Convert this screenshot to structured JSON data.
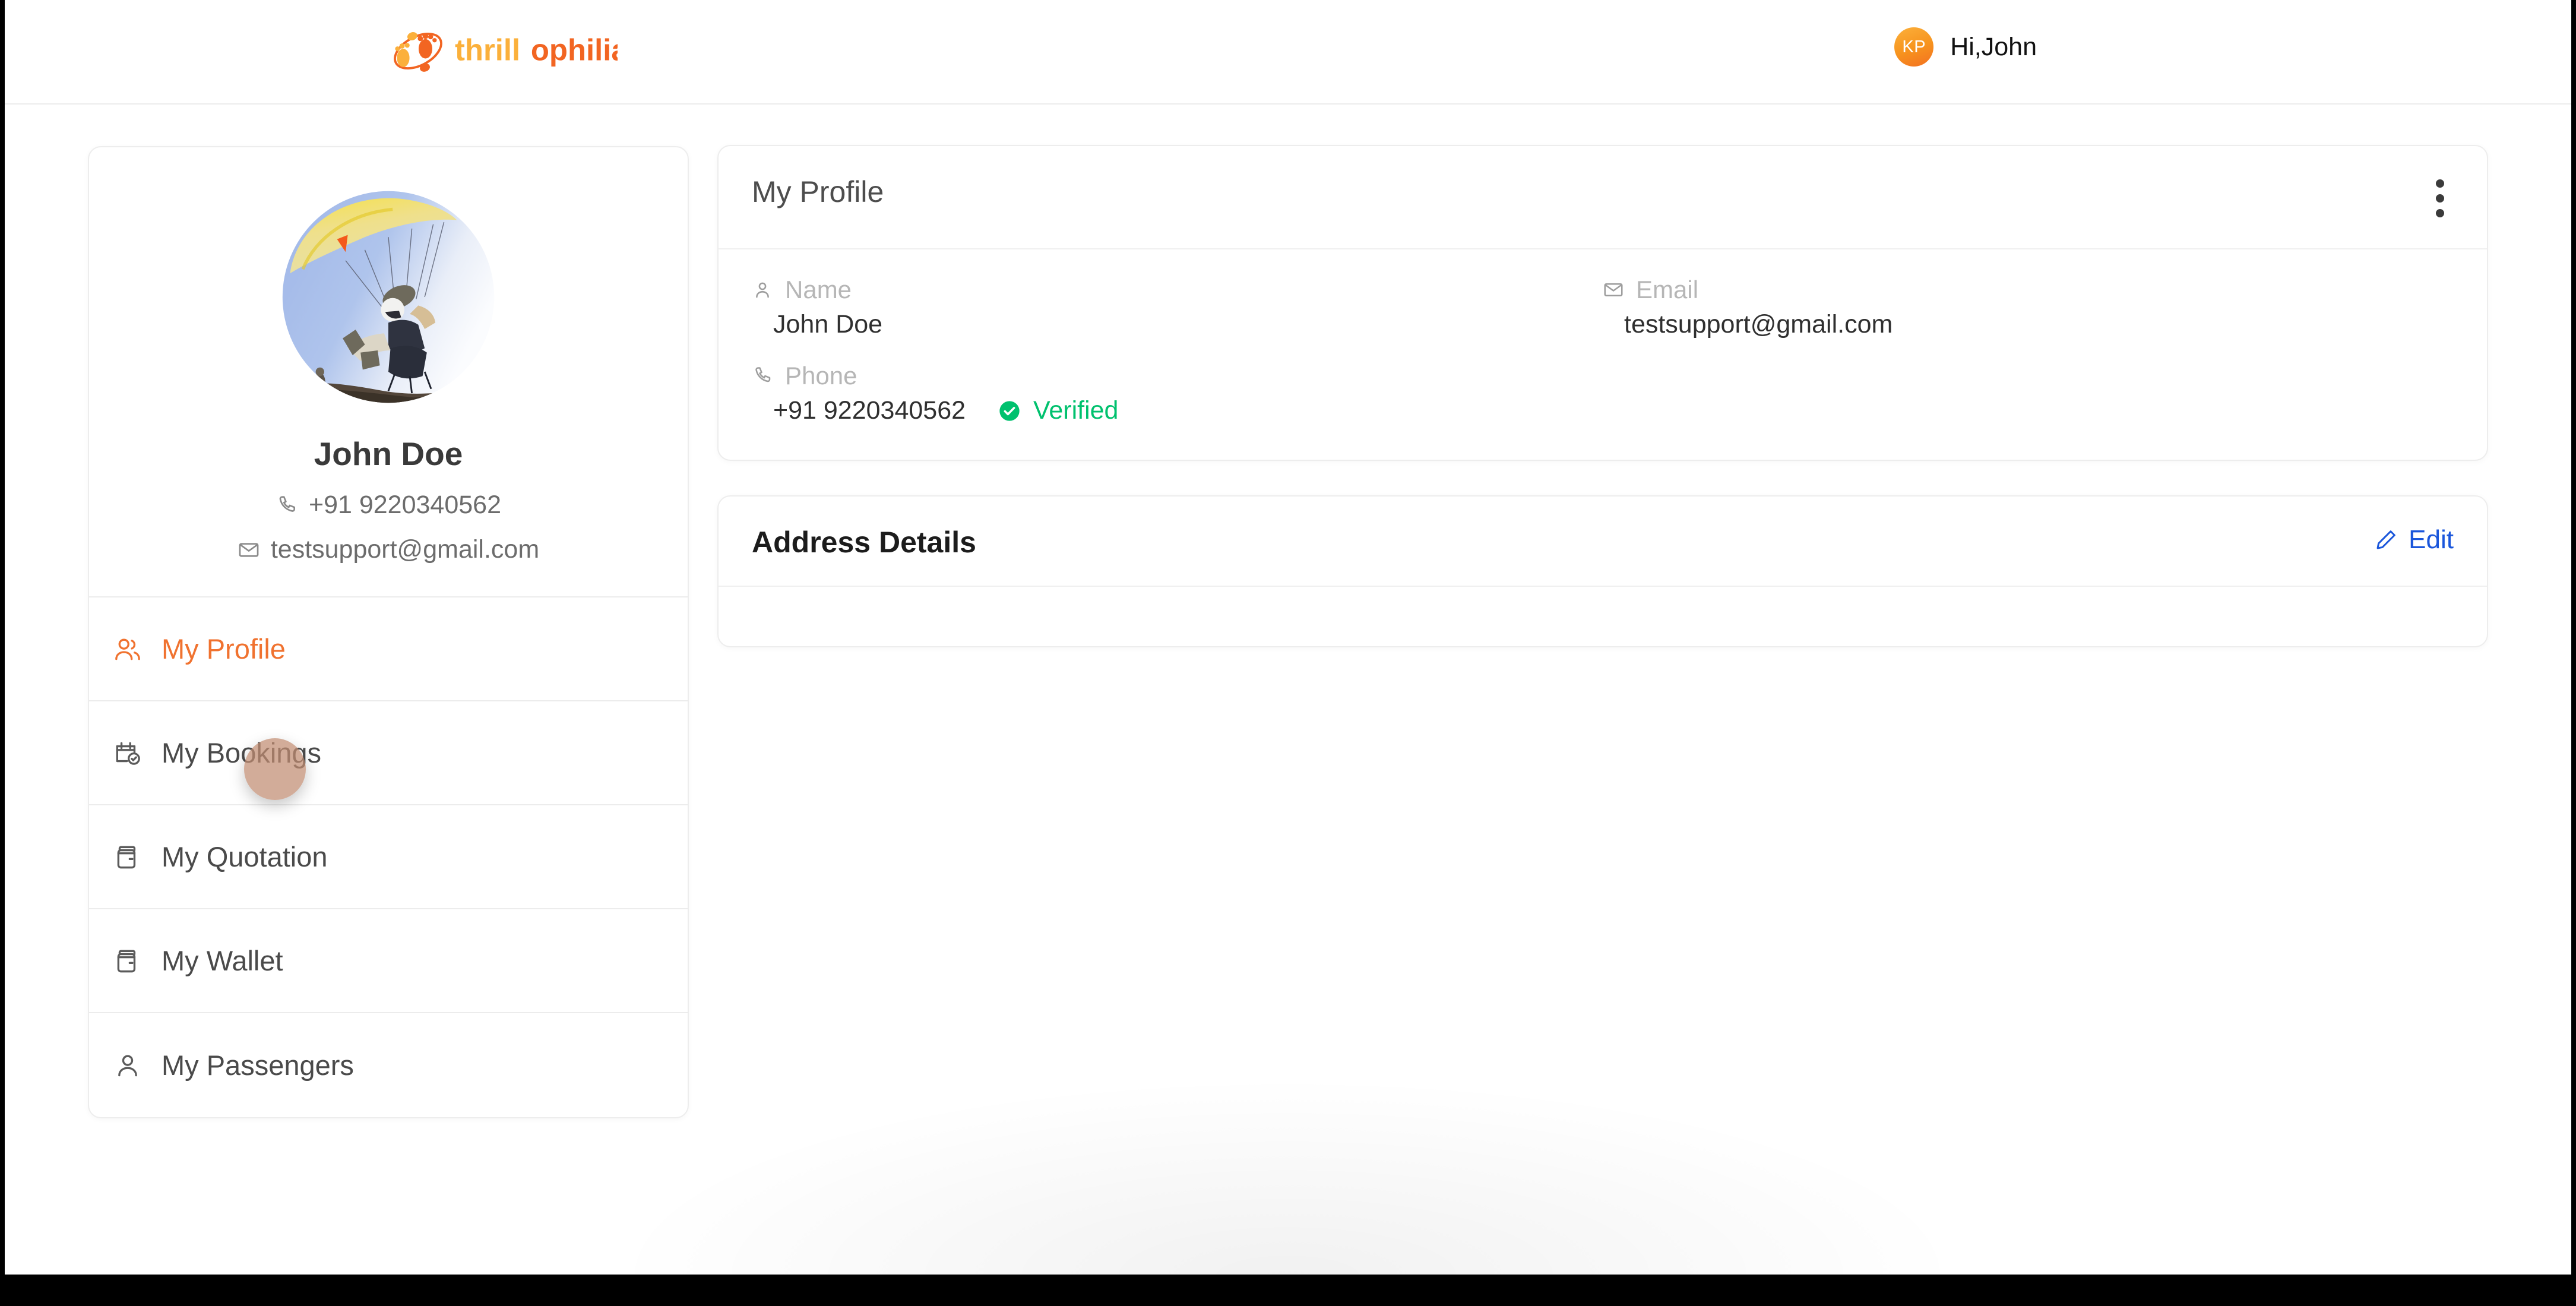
{
  "brand": {
    "name": "thrillophilia",
    "name_part_1": "thrill",
    "name_part_2": "ophilia",
    "color_light": "#FBB03B",
    "color_dark": "#F26522"
  },
  "header": {
    "avatar_initials": "KP",
    "greeting": "Hi,John",
    "avatar_color": "#F7941E"
  },
  "sidebar": {
    "avatar_image": "paragliding-photo",
    "name": "John Doe",
    "phone": "+91 9220340562",
    "email": "testsupport@gmail.com",
    "items": [
      {
        "label": "My Profile",
        "icon": "users-icon",
        "active": true
      },
      {
        "label": "My Bookings",
        "icon": "calendar-check-icon",
        "active": false
      },
      {
        "label": "My Quotation",
        "icon": "wallet-icon",
        "active": false
      },
      {
        "label": "My Wallet",
        "icon": "wallet-icon",
        "active": false
      },
      {
        "label": "My Passengers",
        "icon": "user-icon",
        "active": false
      }
    ],
    "active_color": "#F0722F"
  },
  "profile_card": {
    "title": "My Profile",
    "menu_icon": "kebab-menu-icon",
    "fields": [
      {
        "label": "Name",
        "icon": "user-icon",
        "value": "John Doe"
      },
      {
        "label": "Email",
        "icon": "mail-icon",
        "value": "testsupport@gmail.com"
      },
      {
        "label": "Phone",
        "icon": "phone-icon",
        "value": "+91 9220340562"
      }
    ],
    "verified_label": "Verified",
    "verified_color": "#00C16E"
  },
  "address_card": {
    "title": "Address Details",
    "edit_label": "Edit",
    "edit_icon": "pencil-icon",
    "edit_color": "#1a56db"
  }
}
